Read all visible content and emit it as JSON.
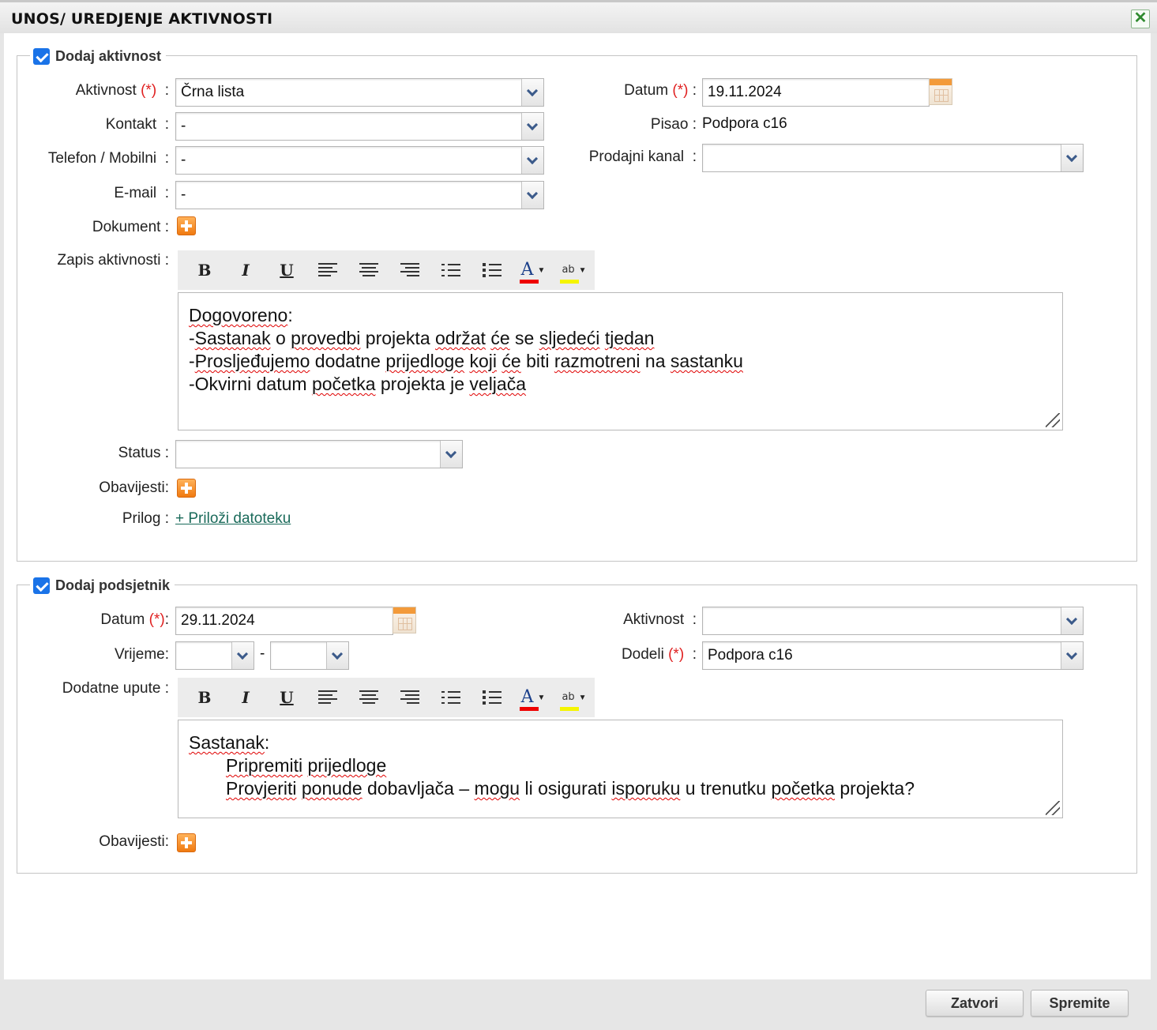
{
  "window": {
    "title": "UNOS/ UREDJENJE AKTIVNOSTI"
  },
  "activity": {
    "legend": "Dodaj aktivnost",
    "aktivnost_label": "Aktivnost",
    "aktivnost_value": "Črna lista",
    "kontakt_label": "Kontakt",
    "kontakt_value": "-",
    "telefon_label": "Telefon / Mobilni",
    "telefon_value": "-",
    "email_label": "E-mail",
    "email_value": "-",
    "dokument_label": "Dokument :",
    "zapis_label": "Zapis aktivnosti :",
    "datum_label": "Datum",
    "datum_value": "19.11.2024",
    "pisao_label": "Pisao :",
    "pisao_value": "Podpora c16",
    "kanal_label": "Prodajni kanal",
    "kanal_value": "",
    "status_label": "Status :",
    "status_value": "",
    "obavijesti_label": "Obavijesti:",
    "prilog_label": "Prilog :",
    "prilog_link": "+ Priloži datoteku"
  },
  "reminder": {
    "legend": "Dodaj podsjetnik",
    "datum_label": "Datum",
    "datum_value": "29.11.2024",
    "vrijeme_label": "Vrijeme:",
    "vrijeme_from": "",
    "vrijeme_to": "",
    "upute_label": "Dodatne upute :",
    "aktivnost_label": "Aktivnost",
    "aktivnost_value": "",
    "dodeli_label": "Dodeli",
    "dodeli_value": "Podpora c16",
    "obavijesti_label": "Obavijesti:"
  },
  "common": {
    "required_mark": "(*)",
    "colon": ":",
    "dash": "-"
  },
  "toolbar": {
    "bold": "B",
    "italic": "I",
    "underline": "U",
    "font_color": "A",
    "highlight": "ab"
  },
  "buttons": {
    "close": "Zatvori",
    "save": "Spremite"
  },
  "icons": {
    "close": "close-icon",
    "calendar": "calendar-icon",
    "add": "add-icon",
    "checkbox": "checkbox-checked-icon"
  },
  "colors": {
    "required": "#e02020",
    "checkbox": "#1a73e8",
    "link": "#1a6a5a",
    "add_icon": "#f07a10"
  }
}
